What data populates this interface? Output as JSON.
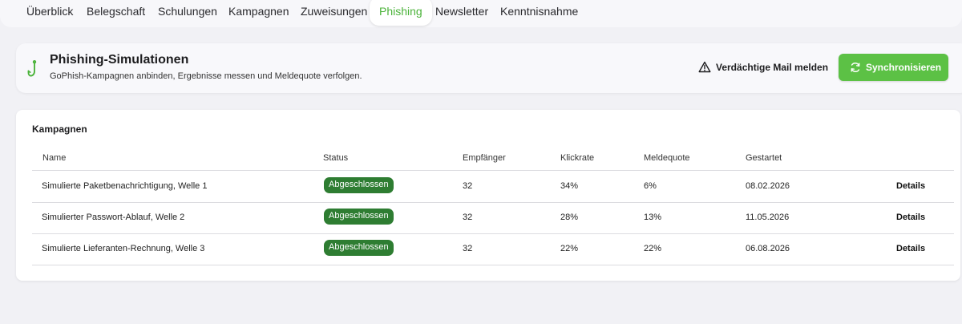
{
  "tabs": [
    {
      "label": "Überblick",
      "active": false
    },
    {
      "label": "Belegschaft",
      "active": false
    },
    {
      "label": "Schulungen",
      "active": false
    },
    {
      "label": "Kampagnen",
      "active": false
    },
    {
      "label": "Zuweisungen",
      "active": false
    },
    {
      "label": "Phishing",
      "active": true
    },
    {
      "label": "Newsletter",
      "active": false
    },
    {
      "label": "Kenntnisnahme",
      "active": false
    }
  ],
  "header": {
    "icon": "fish-hook-icon",
    "title": "Phishing-Simulationen",
    "subtitle": "GoPhish-Kampagnen anbinden, Ergebnisse messen und Meldequote verfolgen.",
    "report_label": "Verdächtige Mail melden",
    "sync_label": "Synchronisieren"
  },
  "colors": {
    "accent": "#5cc145",
    "active_tab_text": "#4bb33a",
    "status_badge": "#2e7d32"
  },
  "table": {
    "title": "Kampagnen",
    "columns": [
      "Name",
      "Status",
      "Empfänger",
      "Klickrate",
      "Meldequote",
      "Gestartet"
    ],
    "rows": [
      {
        "name": "Simulierte Paketbenachrichtigung, Welle 1",
        "status": "Abgeschlossen",
        "recipients": "32",
        "click_rate": "34%",
        "report_rate": "6%",
        "started": "08.02.2026",
        "action": "Details"
      },
      {
        "name": "Simulierter Passwort-Ablauf, Welle 2",
        "status": "Abgeschlossen",
        "recipients": "32",
        "click_rate": "28%",
        "report_rate": "13%",
        "started": "11.05.2026",
        "action": "Details"
      },
      {
        "name": "Simulierte Lieferanten-Rechnung, Welle 3",
        "status": "Abgeschlossen",
        "recipients": "32",
        "click_rate": "22%",
        "report_rate": "22%",
        "started": "06.08.2026",
        "action": "Details"
      }
    ]
  }
}
